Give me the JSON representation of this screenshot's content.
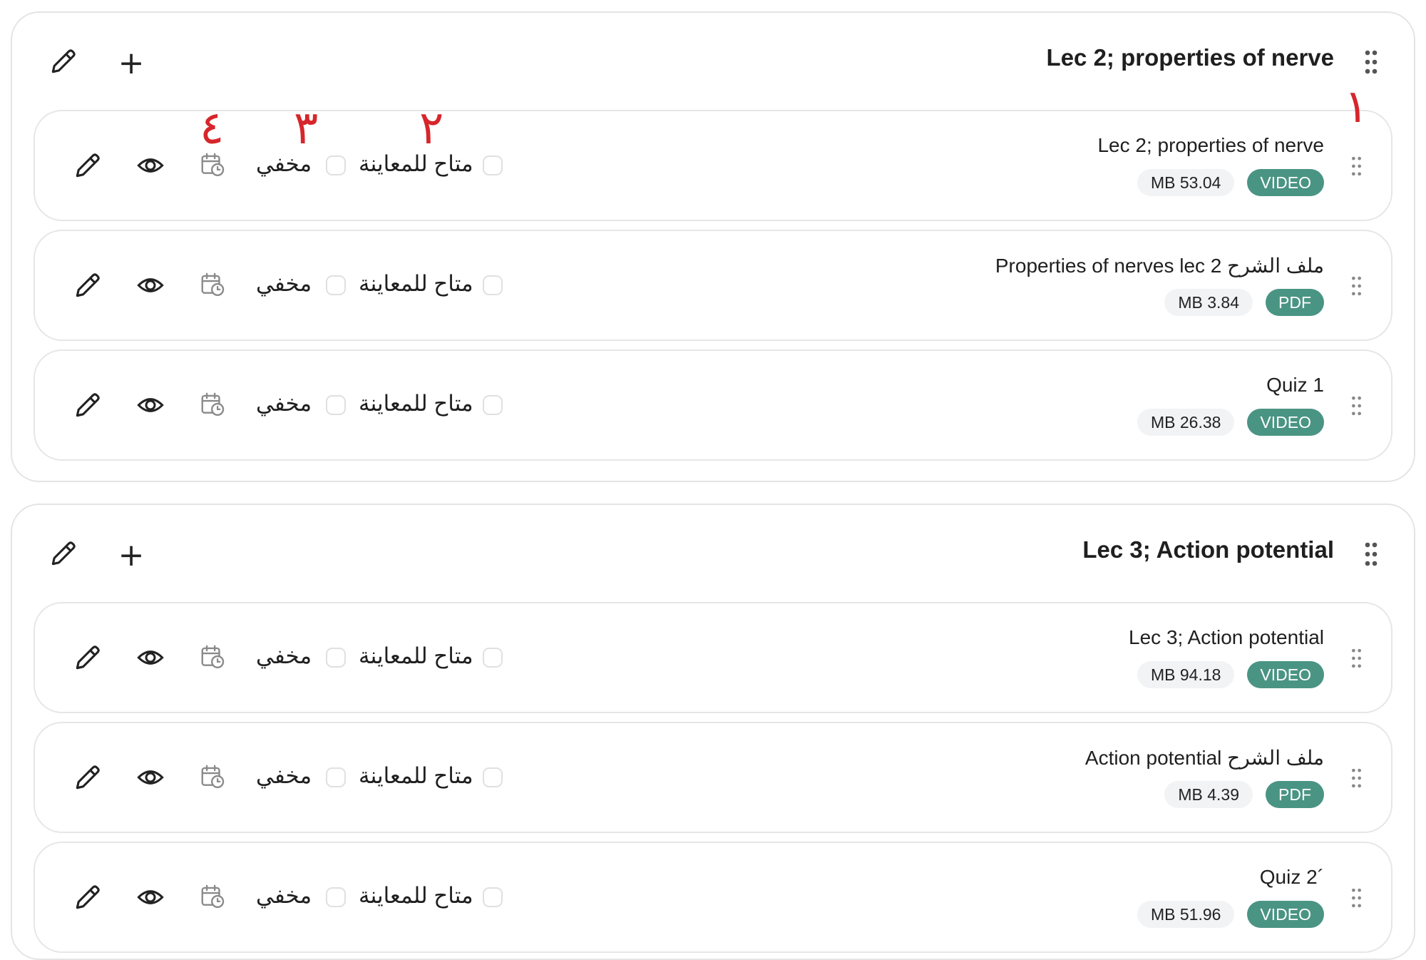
{
  "labels": {
    "preview": "متاح للمعاينة",
    "hidden": "مخفي"
  },
  "annotations": [
    "١",
    "٢",
    "٣",
    "٤"
  ],
  "colors": {
    "badge_type_bg": "#4a9484",
    "badge_size_bg": "#f2f3f5",
    "annotation": "#d6262b"
  },
  "icons": {
    "edit": "pencil-icon",
    "add": "plus-icon",
    "drag": "drag-handle-icon",
    "view": "eye-icon",
    "schedule": "calendar-clock-icon"
  },
  "sections": [
    {
      "title": "Lec 2; properties of nerve",
      "add_label": "+",
      "items": [
        {
          "title": "Lec 2; properties of nerve",
          "type": "VIDEO",
          "size": "MB 53.04"
        },
        {
          "title": "Properties of nerves lec 2 ملف الشرح",
          "type": "PDF",
          "size": "MB 3.84"
        },
        {
          "title": "Quiz 1",
          "type": "VIDEO",
          "size": "MB 26.38"
        }
      ]
    },
    {
      "title": "Lec 3; Action potential",
      "add_label": "+",
      "items": [
        {
          "title": "Lec 3; Action potential",
          "type": "VIDEO",
          "size": "MB 94.18"
        },
        {
          "title": "Action potential ملف الشرح",
          "type": "PDF",
          "size": "MB 4.39"
        },
        {
          "title": "Quiz 2´",
          "type": "VIDEO",
          "size": "MB 51.96"
        }
      ]
    }
  ]
}
